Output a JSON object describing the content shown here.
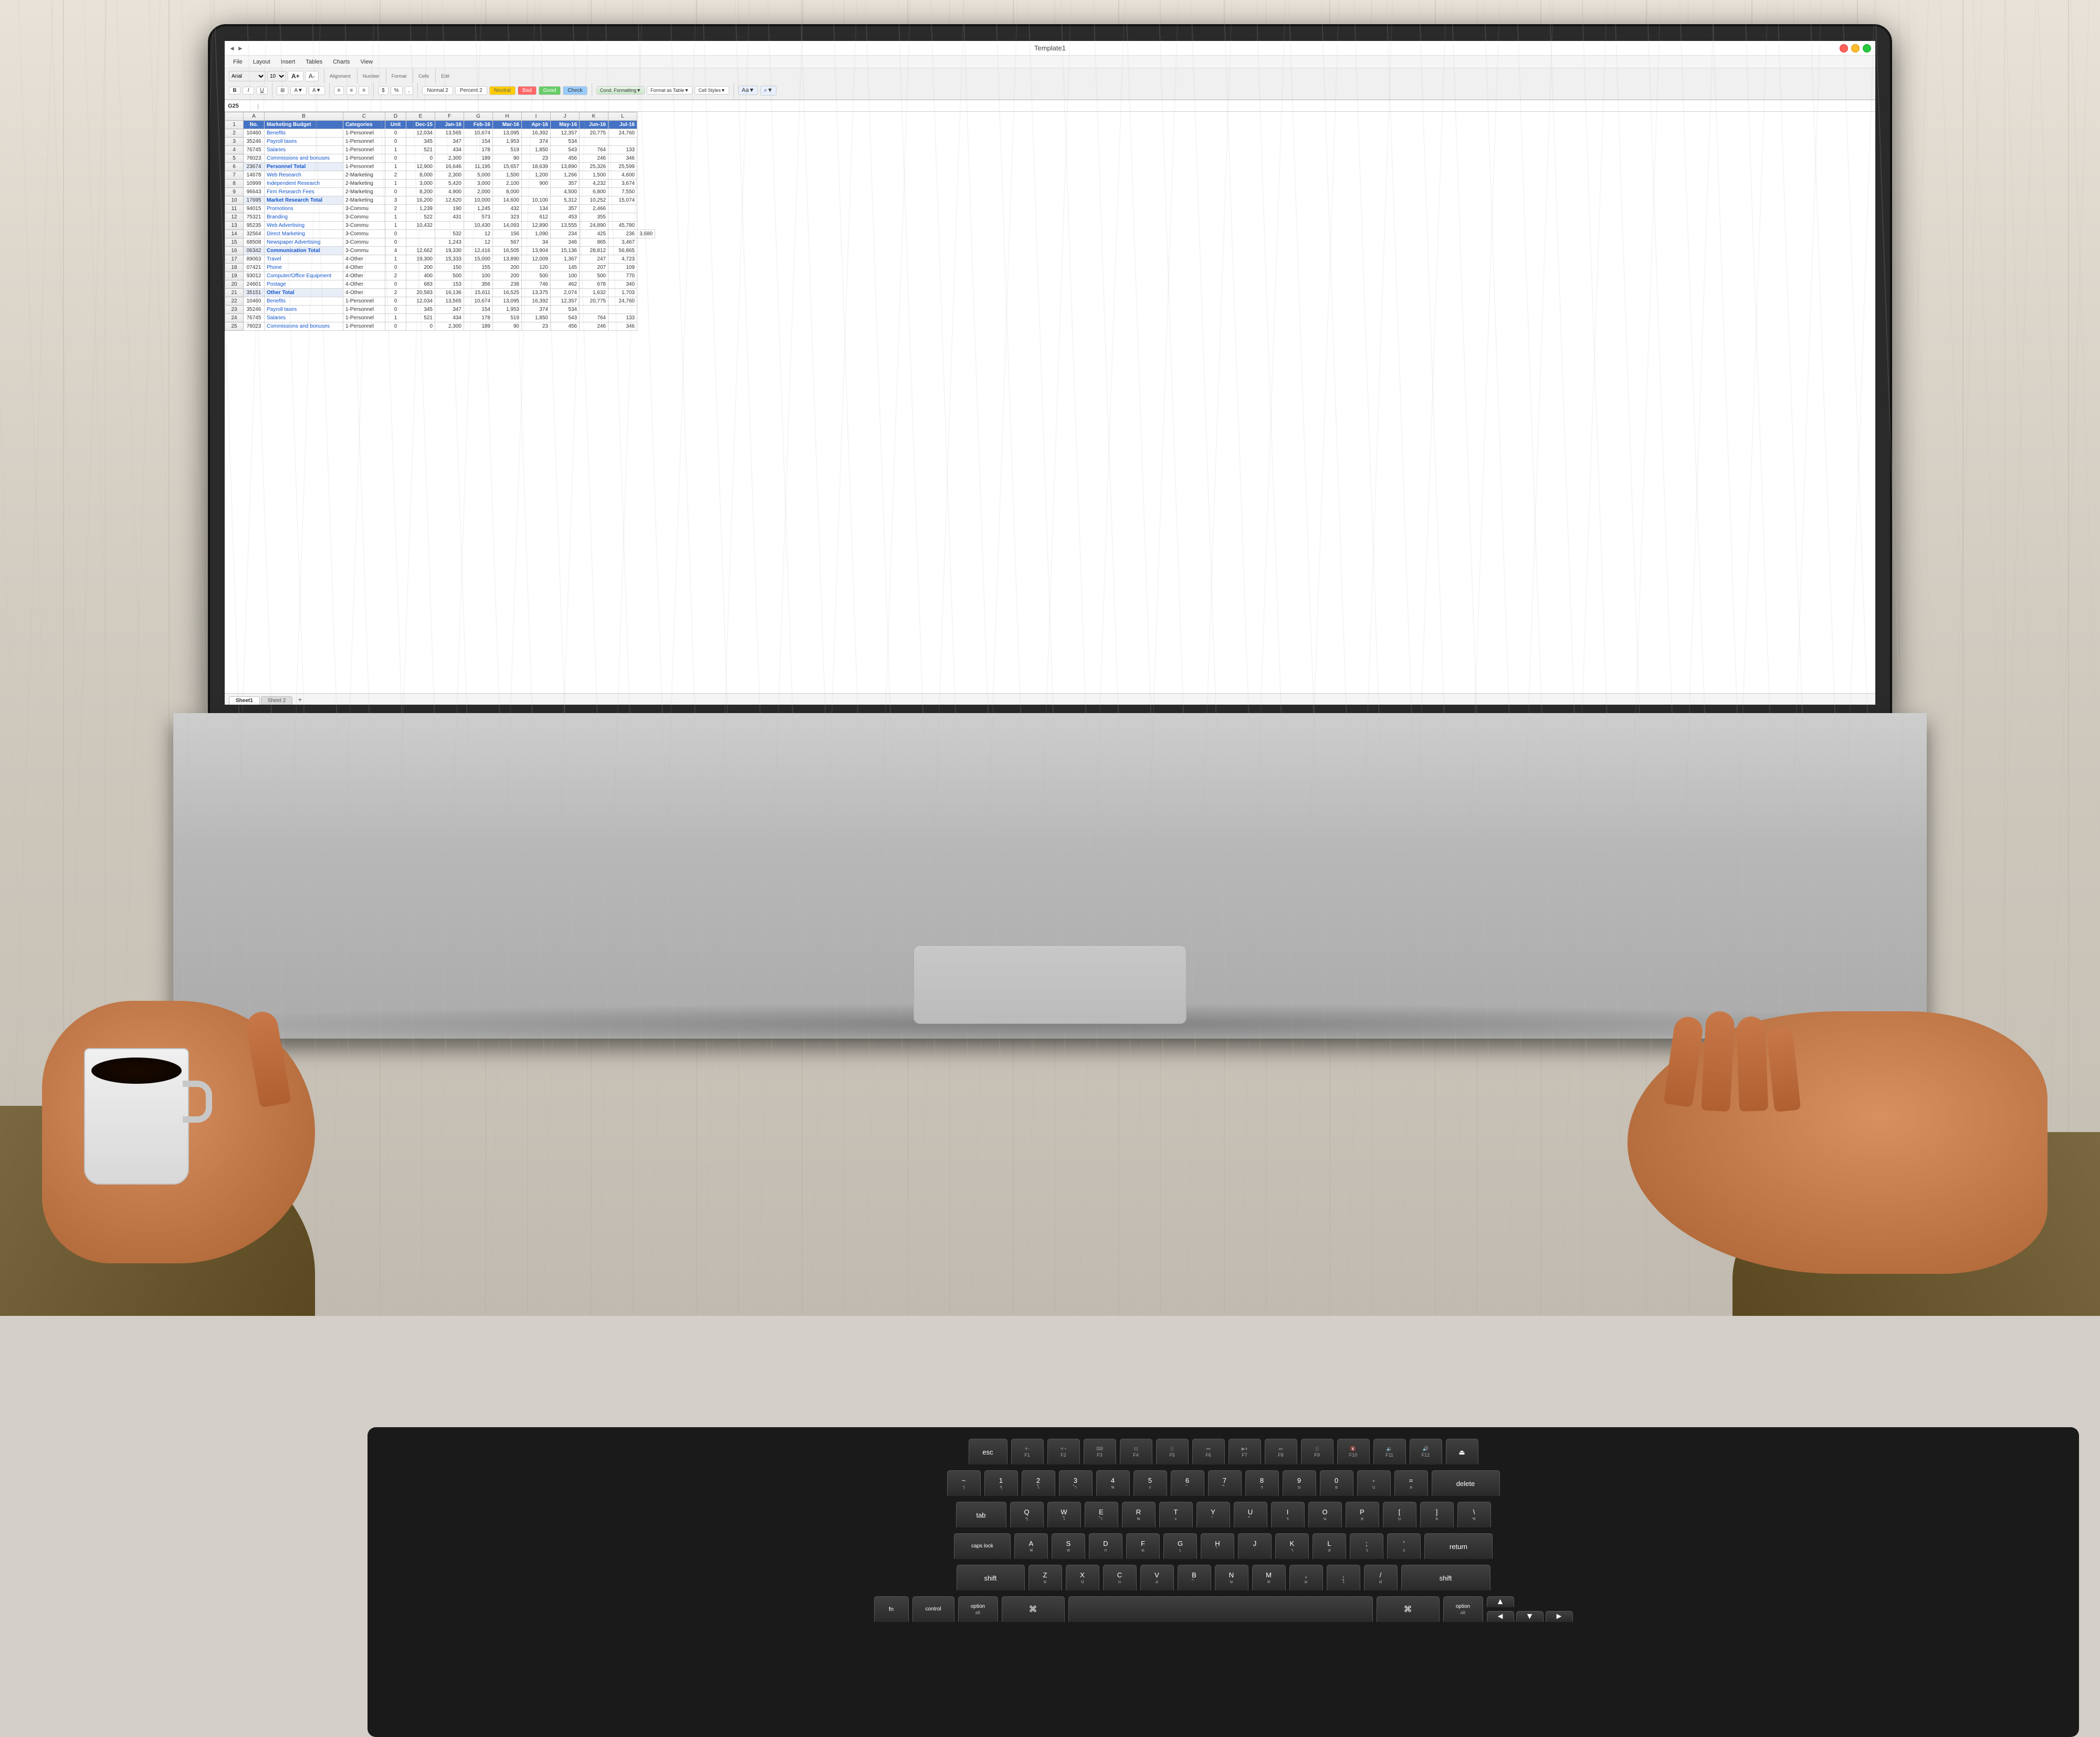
{
  "window": {
    "title": "Template1",
    "controls": [
      "close",
      "minimize",
      "maximize"
    ]
  },
  "menu": {
    "items": [
      "File",
      "Layout",
      "Insert",
      "Tables",
      "Charts",
      "View"
    ]
  },
  "ribbon": {
    "font": "Arial",
    "size": "10",
    "styles": [
      "Normal 2",
      "Percent 2",
      "Neutral",
      "Bad",
      "Good",
      "Check"
    ]
  },
  "formula_bar": {
    "cell": "G25",
    "value": ""
  },
  "sheet_tabs": [
    "Sheet1",
    "Sheet 2"
  ],
  "spreadsheet": {
    "headers": [
      "No.",
      "Marketing Budget",
      "Categories",
      "Unit",
      "Dec-15",
      "Jan-16",
      "Feb-16",
      "Mar-16",
      "Apr-16",
      "May-16",
      "Jun-16",
      "Jul-16"
    ],
    "rows": [
      [
        "10460",
        "Benefits",
        "1-Personnel",
        "0",
        "12,034",
        "13,565",
        "10,674",
        "13,095",
        "16,392",
        "12,357",
        "20,775",
        "24,760"
      ],
      [
        "35246",
        "Payroll taxes",
        "1-Personnel",
        "0",
        "345",
        "347",
        "154",
        "1,953",
        "374",
        "534",
        "",
        ""
      ],
      [
        "76745",
        "Salaries",
        "1-Personnel",
        "1",
        "521",
        "434",
        "178",
        "519",
        "1,850",
        "543",
        "764",
        "133"
      ],
      [
        "76023",
        "Commissions and bonuses",
        "1-Personnel",
        "0",
        "0",
        "2,300",
        "189",
        "90",
        "23",
        "456",
        "246",
        "346"
      ],
      [
        "23674",
        "Personnel Total",
        "1-Personnel",
        "1",
        "12,900",
        "16,646",
        "11,195",
        "15,657",
        "18,639",
        "13,890",
        "25,326",
        "25,599"
      ],
      [
        "14678",
        "Web Research",
        "2-Marketing",
        "2",
        "8,000",
        "2,300",
        "5,000",
        "1,500",
        "1,200",
        "1,266",
        "1,500",
        "4,600"
      ],
      [
        "10999",
        "Independent Research",
        "2-Marketing",
        "1",
        "3,000",
        "5,420",
        "3,000",
        "2,100",
        "900",
        "357",
        "4,232",
        "3,674"
      ],
      [
        "96643",
        "Firm Research Fees",
        "2-Marketing",
        "0",
        "8,200",
        "4,900",
        "2,000",
        "8,000",
        "",
        "4,500",
        "6,800",
        "7,550"
      ],
      [
        "17695",
        "Market Research Total",
        "2-Marketing",
        "3",
        "16,200",
        "12,620",
        "10,000",
        "14,600",
        "10,100",
        "5,312",
        "10,252",
        "15,074"
      ],
      [
        "94015",
        "Promotions",
        "3-Commu",
        "2",
        "1,239",
        "190",
        "1,245",
        "432",
        "134",
        "357",
        "2,466",
        ""
      ],
      [
        "75321",
        "Branding",
        "3-Commu",
        "1",
        "522",
        "431",
        "573",
        "323",
        "612",
        "453",
        "355",
        ""
      ],
      [
        "95235",
        "Web Advertising",
        "3-Commu",
        "1",
        "10,432",
        "",
        "10,430",
        "14,093",
        "12,890",
        "13,555",
        "24,890",
        "45,780"
      ],
      [
        "32564",
        "Direct Marketing",
        "3-Commu",
        "0",
        "",
        "532",
        "12",
        "156",
        "1,090",
        "234",
        "425",
        "236",
        "3,680"
      ],
      [
        "68508",
        "Newspaper Advertising",
        "3-Commu",
        "0",
        "",
        "1,243",
        "12",
        "567",
        "34",
        "346",
        "865",
        "3,467"
      ],
      [
        "06342",
        "Communication Total",
        "3-Commu",
        "4",
        "12,662",
        "19,330",
        "12,416",
        "16,505",
        "13,904",
        "15,136",
        "28,812",
        "56,865"
      ],
      [
        "89063",
        "Travel",
        "4-Other",
        "1",
        "19,300",
        "15,333",
        "15,000",
        "13,890",
        "12,009",
        "1,367",
        "247",
        "4,723"
      ],
      [
        "07421",
        "Phone",
        "4-Other",
        "0",
        "200",
        "150",
        "155",
        "200",
        "120",
        "145",
        "207",
        "109"
      ],
      [
        "93012",
        "Computer/Office Equipment",
        "4-Other",
        "2",
        "400",
        "500",
        "100",
        "200",
        "500",
        "100",
        "500",
        "770"
      ],
      [
        "24601",
        "Postage",
        "4-Other",
        "0",
        "683",
        "153",
        "356",
        "238",
        "746",
        "462",
        "678",
        "340"
      ],
      [
        "35151",
        "Other Total",
        "4-Other",
        "2",
        "20,583",
        "16,136",
        "15,611",
        "16,525",
        "13,375",
        "2,074",
        "1,632",
        "1,703"
      ],
      [
        "10460",
        "Benefits",
        "1-Personnel",
        "0",
        "12,034",
        "13,565",
        "10,674",
        "13,095",
        "16,392",
        "12,357",
        "20,775",
        "24,760"
      ],
      [
        "35246",
        "Payroll taxes",
        "1-Personnel",
        "0",
        "345",
        "347",
        "154",
        "1,953",
        "374",
        "534",
        "",
        ""
      ],
      [
        "76745",
        "Salaries",
        "1-Personnel",
        "1",
        "521",
        "434",
        "178",
        "519",
        "1,850",
        "543",
        "764",
        "133"
      ],
      [
        "76023",
        "Commissions and bonuses",
        "1-Personnel",
        "0",
        "0",
        "2,300",
        "189",
        "90",
        "23",
        "456",
        "246",
        "346"
      ]
    ]
  },
  "keyboard": {
    "fn_row": [
      "esc",
      "F1",
      "F2",
      "F3",
      "F4",
      "F5",
      "F6",
      "F7",
      "F8",
      "F9",
      "F10",
      "F11",
      "F12",
      "⏏"
    ],
    "row1": [
      "~`",
      "1!",
      "2@",
      "3#",
      "4$",
      "5%",
      "6^",
      "7&",
      "8*",
      "9(",
      "0)",
      "-_",
      "=+",
      "delete"
    ],
    "row2": [
      "tab",
      "Q",
      "W",
      "E",
      "R",
      "T",
      "Y",
      "U",
      "I",
      "O",
      "P",
      "[{",
      "]}",
      "\\|"
    ],
    "row3": [
      "caps lock",
      "A",
      "S",
      "D",
      "F",
      "G",
      "H",
      "J",
      "K",
      "L",
      ";:",
      "'\"",
      "return"
    ],
    "row4": [
      "shift",
      "Z",
      "X",
      "C",
      "V",
      "B",
      "N",
      "M",
      ",<",
      ".>",
      "/?",
      "shift"
    ],
    "row5": [
      "fn",
      "control",
      "option",
      "space",
      "option",
      "◄",
      "▼▲",
      "►"
    ]
  },
  "colors": {
    "accent_blue": "#4472c4",
    "style_normal2": "#ffffff",
    "style_percent2": "#ffffff",
    "style_neutral": "#ffff00",
    "style_bad": "#ff6666",
    "style_good": "#92d050",
    "style_check": "#9dc3e6",
    "keyboard_bg": "#1a1a1a",
    "key_bg": "#333333",
    "laptop_silver": "#c8c8c8"
  }
}
